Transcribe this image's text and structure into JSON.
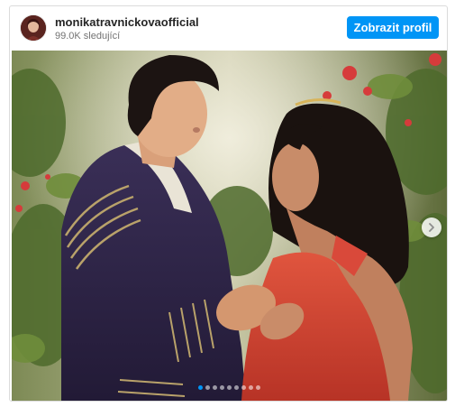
{
  "post": {
    "username": "monikatravnickovaofficial",
    "followers": "99.0K sledující",
    "view_profile_label": "Zobrazit profil"
  },
  "carousel": {
    "slide_count": 9,
    "active_index": 0
  },
  "colors": {
    "button": "#0095f6",
    "username": "#262626",
    "subtext": "#737373"
  },
  "icons": {
    "next": "chevron-right-icon"
  }
}
